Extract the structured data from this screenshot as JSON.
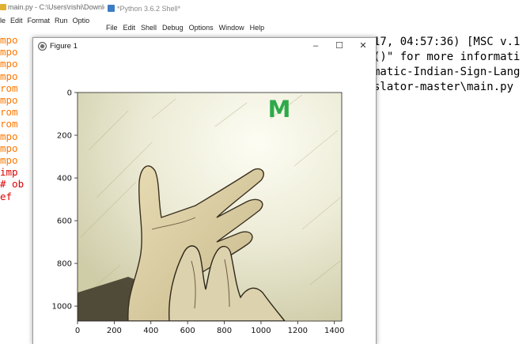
{
  "editor": {
    "title": "main.py - C:\\Users\\rishi\\Downlo",
    "menu": [
      "ile",
      "Edit",
      "Format",
      "Run",
      "Optio"
    ],
    "code_lines": [
      "mpo",
      "mpo",
      "mpo",
      "mpo",
      "rom",
      "mpo",
      "rom",
      "rom",
      "mpo",
      "mpo",
      "mpo",
      "imp",
      "# ob",
      "ef"
    ]
  },
  "shell": {
    "title": "*Python 3.6.2 Shell*",
    "menu": [
      "File",
      "Edit",
      "Shell",
      "Debug",
      "Options",
      "Window",
      "Help"
    ],
    "lines": [
      "17, 04:57:36) [MSC v.1",
      "",
      "()\" for more informati",
      "",
      "matic-Indian-Sign-Lang",
      "slator-master\\main.py"
    ]
  },
  "figure": {
    "title": "Figure 1",
    "window_buttons": [
      "–",
      "☐",
      "✕"
    ],
    "prediction": "M",
    "prediction_color": "#2eaa4a",
    "axes": {
      "x_ticks": [
        "0",
        "200",
        "400",
        "600",
        "800",
        "1000",
        "1200",
        "1400"
      ],
      "y_ticks": [
        "0",
        "200",
        "400",
        "600",
        "800",
        "1000"
      ],
      "x_range": [
        0,
        1440
      ],
      "y_range": [
        1070,
        0
      ]
    }
  }
}
